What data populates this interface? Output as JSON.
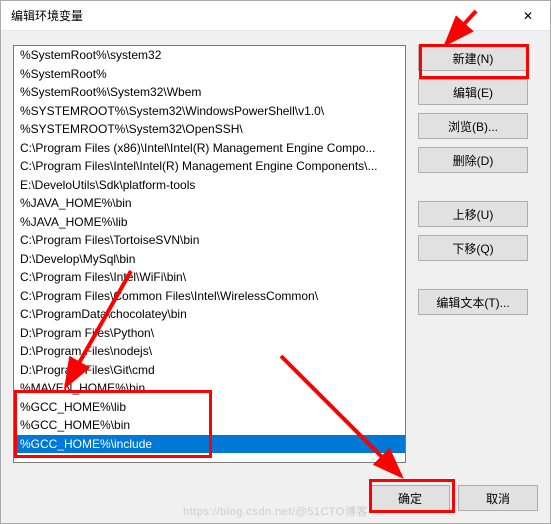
{
  "window": {
    "title": "编辑环境变量",
    "close_glyph": "✕"
  },
  "list": {
    "items": [
      "%SystemRoot%\\system32",
      "%SystemRoot%",
      "%SystemRoot%\\System32\\Wbem",
      "%SYSTEMROOT%\\System32\\WindowsPowerShell\\v1.0\\",
      "%SYSTEMROOT%\\System32\\OpenSSH\\",
      "C:\\Program Files (x86)\\Intel\\Intel(R) Management Engine Compo...",
      "C:\\Program Files\\Intel\\Intel(R) Management Engine Components\\...",
      "E:\\DeveloUtils\\Sdk\\platform-tools",
      "%JAVA_HOME%\\bin",
      "%JAVA_HOME%\\lib",
      "C:\\Program Files\\TortoiseSVN\\bin",
      "D:\\Develop\\MySql\\bin",
      "C:\\Program Files\\Intel\\WiFi\\bin\\",
      "C:\\Program Files\\Common Files\\Intel\\WirelessCommon\\",
      "C:\\ProgramData\\chocolatey\\bin",
      "D:\\Program Files\\Python\\",
      "D:\\Program Files\\nodejs\\",
      "D:\\Program Files\\Git\\cmd",
      "%MAVEN_HOME%\\bin",
      "%GCC_HOME%\\lib",
      "%GCC_HOME%\\bin",
      "%GCC_HOME%\\include"
    ],
    "selected_index": 21
  },
  "buttons": {
    "new": "新建(N)",
    "edit": "编辑(E)",
    "browse": "浏览(B)...",
    "delete": "删除(D)",
    "move_up": "上移(U)",
    "move_down": "下移(Q)",
    "edit_text": "编辑文本(T)...",
    "ok": "确定",
    "cancel": "取消"
  },
  "watermark": "https://blog.csdn.net/@51CTO博客",
  "colors": {
    "highlight_red": "#ff0000",
    "selection_blue": "#0078d7"
  }
}
